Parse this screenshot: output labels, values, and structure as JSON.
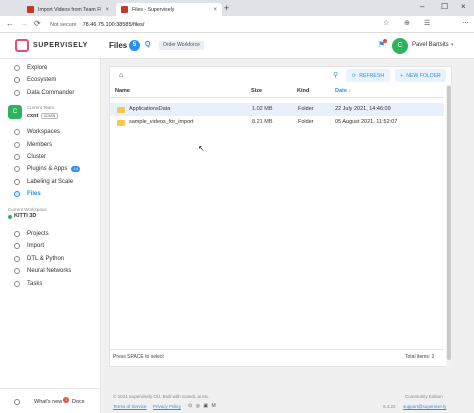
{
  "browser": {
    "tabs": [
      {
        "title": "Import Videos from Team Files o",
        "close": "×"
      },
      {
        "title": "Files - Supervisely",
        "close": "×"
      }
    ],
    "new_tab": "+",
    "window_controls": {
      "minimize": "–",
      "maximize": "☐",
      "close": "×"
    },
    "security": "Not secure",
    "url": "78.46.75.100:38585/files/",
    "nav": {
      "back": "←",
      "forward": "→",
      "reload": "⟳"
    },
    "toolbar_icons": [
      "☆",
      "⊕",
      "☰",
      "⋯"
    ]
  },
  "app": {
    "logo_text": "SUPERVISELY",
    "page_title": "Files",
    "help_badge": "5",
    "q_icon": "Q",
    "workspace_chip": "Order Workforce",
    "user": {
      "initial": "C",
      "name": "Pavel Bartsits",
      "caret": "▾"
    }
  },
  "sidebar": {
    "top_items": [
      {
        "label": "Explore"
      },
      {
        "label": "Ecosystem"
      },
      {
        "label": "Data Commander"
      }
    ],
    "team": {
      "caption": "Current Team",
      "initial": "C",
      "name": "cxnt",
      "role": "ADMIN"
    },
    "team_items": [
      {
        "label": "Workspaces"
      },
      {
        "label": "Members"
      },
      {
        "label": "Cluster"
      },
      {
        "label": "Plugins & Apps",
        "badge": "14"
      },
      {
        "label": "Labeling at Scale"
      },
      {
        "label": "Files",
        "active": true
      }
    ],
    "workspace": {
      "caption": "Current Workspace",
      "name": "KITTI 3D"
    },
    "workspace_items": [
      {
        "label": "Projects"
      },
      {
        "label": "Import"
      },
      {
        "label": "DTL & Python"
      },
      {
        "label": "Neural Networks"
      },
      {
        "label": "Tasks"
      }
    ],
    "whats_new": "What's new",
    "whats_new_badge": "1",
    "docs": "Docs"
  },
  "files": {
    "home_icon": "⌂",
    "search_icon": "⚲",
    "refresh_label": "REFRESH",
    "new_folder_label": "NEW FOLDER",
    "columns": {
      "name": "Name",
      "size": "Size",
      "kind": "Kind",
      "date": "Date ↓"
    },
    "rows": [
      {
        "name": "ApplicationsData",
        "size": "1.02 MB",
        "kind": "Folder",
        "date": "22 July 2021, 14:46:09",
        "selected": true
      },
      {
        "name": "sample_videos_for_import",
        "size": "8.21 MB",
        "kind": "Folder",
        "date": "05 August 2021, 11:52:07",
        "selected": false
      }
    ],
    "footer_hint": "Press SPACE to select",
    "total_items": "Total items: 2"
  },
  "footer": {
    "copyright": "© 2021 Supervisely OÜ. Built with scandi, ai etc.",
    "terms": "Terms of Service",
    "privacy": "Privacy Policy",
    "social_icons": "⊙ ◎ ▣ M",
    "edition": "Community Edition",
    "version": "6.4.22",
    "support_email": "support@supervise.ly"
  },
  "colors": {
    "accent": "#2b8ef0",
    "brand": "#e24d7a",
    "green": "#2db35d",
    "folder": "#f7c948"
  }
}
